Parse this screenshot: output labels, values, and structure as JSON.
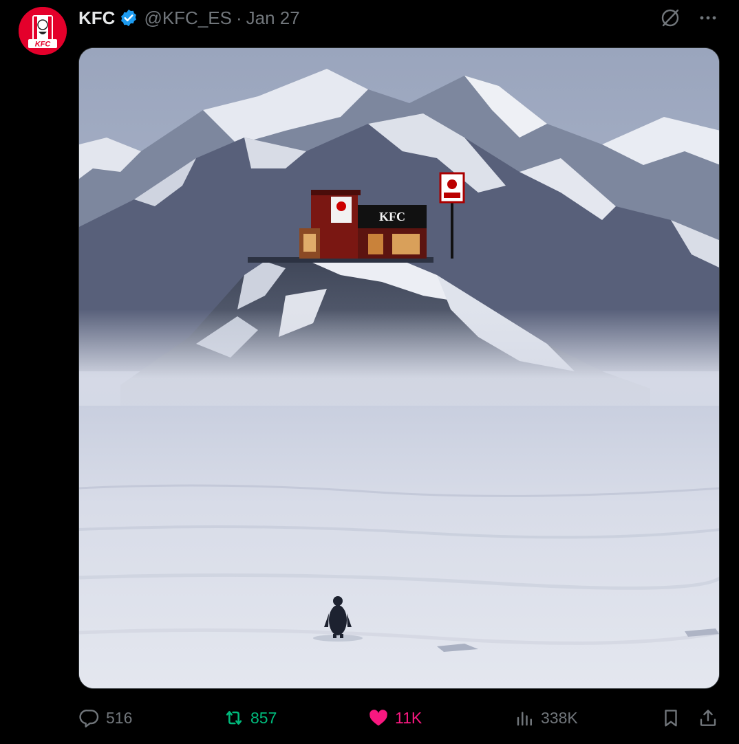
{
  "tweet": {
    "author": {
      "display_name": "KFC",
      "handle": "@KFC_ES",
      "verified": true,
      "avatar_text": "KFC"
    },
    "separator": "·",
    "date": "Jan 27",
    "media": {
      "sign_text": "KFC"
    },
    "actions": {
      "replies": "516",
      "retweets": "857",
      "likes": "11K",
      "views": "338K"
    }
  },
  "colors": {
    "background": "#000000",
    "text_primary": "#e7e9ea",
    "text_secondary": "#71767b",
    "verified_blue": "#1d9bf0",
    "retweet_green": "#00ba7c",
    "like_pink": "#f91880",
    "kfc_red": "#e4002b"
  },
  "icons": [
    "grok-icon",
    "more-icon",
    "reply-icon",
    "retweet-icon",
    "like-icon",
    "views-icon",
    "bookmark-icon",
    "share-icon",
    "verified-badge-icon"
  ]
}
